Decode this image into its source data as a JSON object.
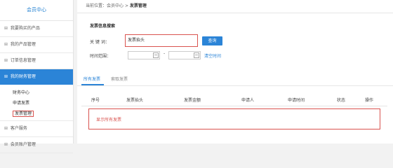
{
  "sidebar": {
    "title": "会员中心",
    "items": [
      {
        "label": "我要购买的产品"
      },
      {
        "label": "我的产品管理"
      },
      {
        "label": "订单信息管理"
      },
      {
        "label": "我的财务管理"
      }
    ],
    "sub_items": [
      {
        "label": "财务中心"
      },
      {
        "label": "申请发票"
      },
      {
        "label": "发票管理"
      }
    ],
    "bottom_items": [
      {
        "label": "客户服务"
      },
      {
        "label": "会员账户管理"
      }
    ],
    "plus_glyph": "⊞"
  },
  "breadcrumb": {
    "prefix": "当前位置：",
    "level1": "会员中心",
    "sep": " > ",
    "current": "发票管理"
  },
  "search": {
    "title": "发票信息搜索",
    "keyword_label": "关 键 词：",
    "keyword_value": "发票抬头",
    "search_button": "查询",
    "time_label": "时间范围：",
    "range_sep": "-",
    "clear_time": "清空时间"
  },
  "tabs": [
    {
      "label": "所有发票"
    },
    {
      "label": "索取发票"
    }
  ],
  "table": {
    "headers": [
      "序号",
      "发票抬头",
      "发票金额",
      "申请人",
      "申请时间",
      "状态",
      "操作"
    ],
    "empty_text": "显示所有发票"
  },
  "colors": {
    "accent": "#2b84d7",
    "highlight": "#d9534f"
  }
}
